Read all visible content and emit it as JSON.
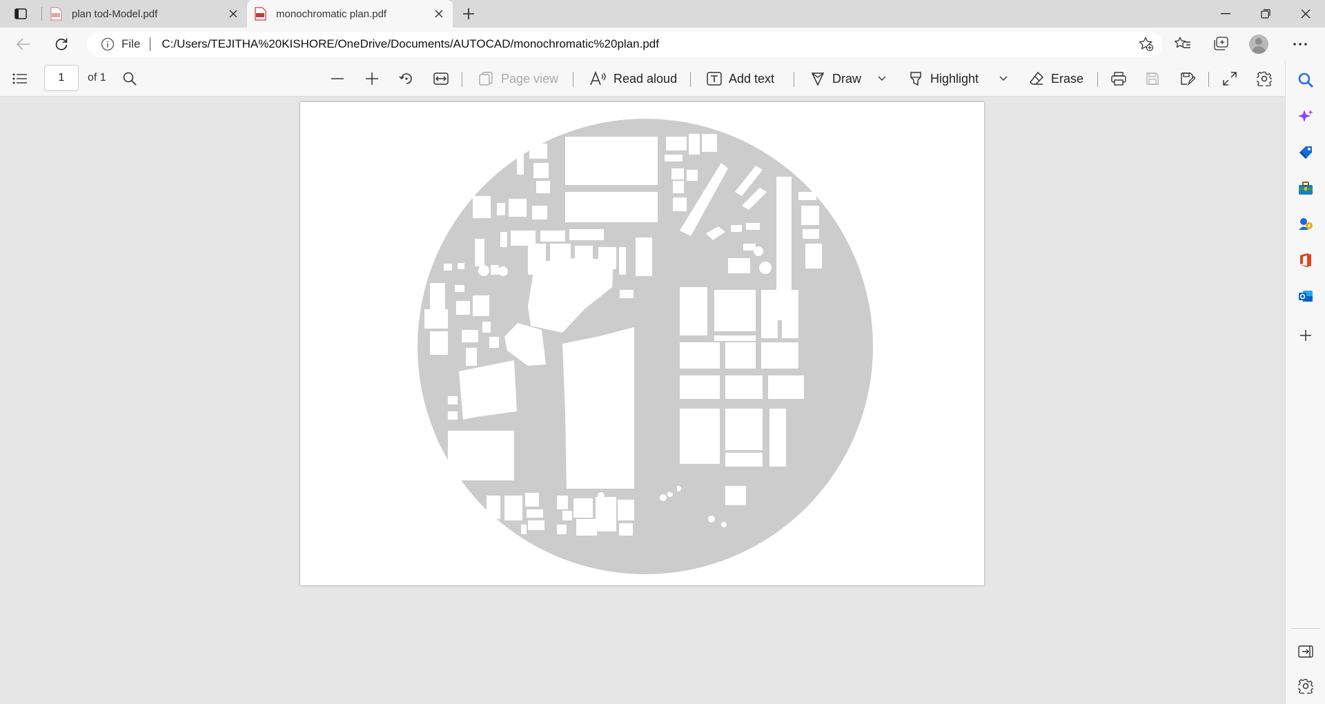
{
  "tabs": [
    {
      "title": "plan tod-Model.pdf",
      "active": false,
      "icon": "pdf-icon"
    },
    {
      "title": "monochromatic plan.pdf",
      "active": true,
      "icon": "pdf-icon"
    }
  ],
  "address": {
    "scheme_label": "File",
    "url": "C:/Users/TEJITHA%20KISHORE/OneDrive/Documents/AUTOCAD/monochromatic%20plan.pdf"
  },
  "pdf_toolbar": {
    "page_current": "1",
    "page_of": "of 1",
    "page_view": "Page view",
    "read_aloud": "Read aloud",
    "add_text": "Add text",
    "draw": "Draw",
    "highlight": "Highlight",
    "erase": "Erase"
  },
  "document": {
    "page_color": "#ffffff",
    "mass_color": "#cccccc"
  },
  "colors": {
    "pdf_red": "#d13438",
    "sidebar_search": "#2b6fd6",
    "copilot_purple": "#8a3ffc",
    "shopping_blue": "#1769d8",
    "office_orange": "#e2421b",
    "outlook_blue": "#0a64c8"
  },
  "sidebar": [
    {
      "name": "search-icon"
    },
    {
      "name": "copilot-icon"
    },
    {
      "name": "shopping-icon"
    },
    {
      "name": "tools-icon"
    },
    {
      "name": "games-icon"
    },
    {
      "name": "office-icon"
    },
    {
      "name": "outlook-icon"
    },
    {
      "name": "add-icon"
    }
  ]
}
